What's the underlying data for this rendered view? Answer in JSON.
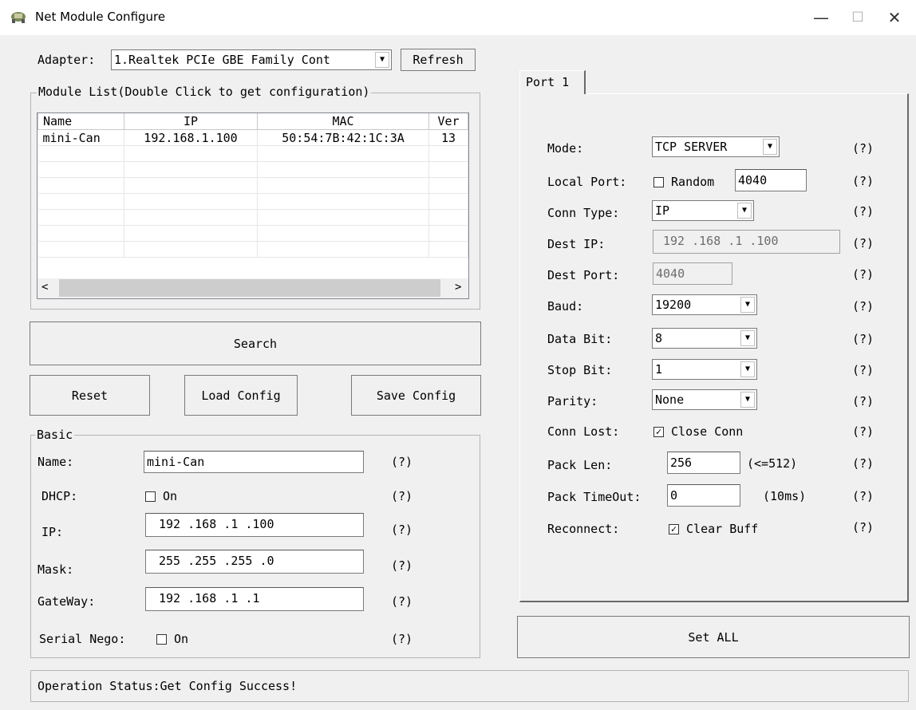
{
  "window": {
    "title": "Net Module Configure",
    "minimize_glyph": "—",
    "maximize_glyph": "☐",
    "close_glyph": "✕",
    "icon": "network-app-icon"
  },
  "adapter": {
    "label": "Adapter:",
    "value": "1.Realtek PCIe GBE Family Cont",
    "refresh_label": "Refresh"
  },
  "module_list": {
    "title": "Module List(Double Click to get configuration)",
    "columns": [
      "Name",
      "IP",
      "MAC",
      "Ver"
    ],
    "rows": [
      {
        "name": "mini-Can",
        "ip": "192.168.1.100",
        "mac": "50:54:7B:42:1C:3A",
        "ver": "13"
      }
    ]
  },
  "buttons": {
    "search": "Search",
    "reset": "Reset",
    "load_config": "Load Config",
    "save_config": "Save Config",
    "set_all": "Set ALL"
  },
  "basic": {
    "title": "Basic",
    "name_label": "Name:",
    "name_value": "mini-Can",
    "dhcp_label": "DHCP:",
    "dhcp_check": "On",
    "dhcp_checked": false,
    "ip_label": "IP:",
    "ip": [
      "192",
      "168",
      "1",
      "100"
    ],
    "mask_label": "Mask:",
    "mask": [
      "255",
      "255",
      "255",
      "0"
    ],
    "gateway_label": "GateWay:",
    "gateway": [
      "192",
      "168",
      "1",
      "1"
    ],
    "serial_label": "Serial Nego:",
    "serial_check": "On",
    "serial_checked": false,
    "help": "(?)"
  },
  "port": {
    "tab": "Port 1",
    "mode_label": "Mode:",
    "mode_value": "TCP SERVER",
    "local_port_label": "Local Port:",
    "random_label": "Random",
    "random_checked": false,
    "local_port_value": "4040",
    "conn_type_label": "Conn Type:",
    "conn_type_value": "IP",
    "dest_ip_label": "Dest IP:",
    "dest_ip": [
      "192",
      "168",
      "1",
      "100"
    ],
    "dest_port_label": "Dest Port:",
    "dest_port_value": "4040",
    "baud_label": "Baud:",
    "baud_value": "19200",
    "data_bit_label": "Data Bit:",
    "data_bit_value": "8",
    "stop_bit_label": "Stop Bit:",
    "stop_bit_value": "1",
    "parity_label": "Parity:",
    "parity_value": "None",
    "conn_lost_label": "Conn Lost:",
    "conn_lost_check": "Close Conn",
    "conn_lost_checked": true,
    "pack_len_label": "Pack Len:",
    "pack_len_value": "256",
    "pack_len_hint": "(<=512)",
    "pack_timeout_label": "Pack TimeOut:",
    "pack_timeout_value": "0",
    "pack_timeout_hint": "(10ms)",
    "reconnect_label": "Reconnect:",
    "reconnect_check": "Clear Buff",
    "reconnect_checked": true,
    "help": "(?)"
  },
  "status": {
    "text": "Operation Status:Get Config Success!"
  }
}
